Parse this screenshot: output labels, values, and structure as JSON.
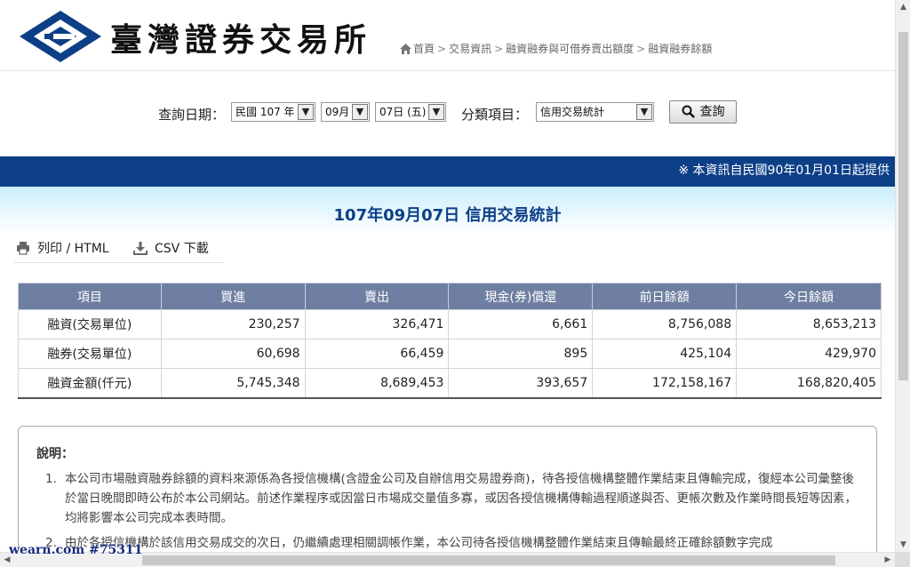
{
  "header": {
    "logo_text": "臺灣證券交易所",
    "breadcrumb": [
      "首頁",
      "交易資訊",
      "融資融券與可借券賣出額度",
      "融資融券餘額"
    ]
  },
  "query": {
    "date_label": "查詢日期：",
    "year": "民國 107 年",
    "month": "09月",
    "day": "07日 (五)",
    "category_label": "分類項目：",
    "category": "信用交易統計",
    "button_label": "查詢"
  },
  "notice": "※ 本資訊自民國90年01月01日起提供",
  "title": "107年09月07日 信用交易統計",
  "tools": {
    "print": "列印 / HTML",
    "csv": "CSV 下載"
  },
  "table": {
    "headers": [
      "項目",
      "買進",
      "賣出",
      "現金(券)償還",
      "前日餘額",
      "今日餘額"
    ],
    "rows": [
      [
        "融資(交易單位)",
        "230,257",
        "326,471",
        "6,661",
        "8,756,088",
        "8,653,213"
      ],
      [
        "融券(交易單位)",
        "60,698",
        "66,459",
        "895",
        "425,104",
        "429,970"
      ],
      [
        "融資金額(仟元)",
        "5,745,348",
        "8,689,453",
        "393,657",
        "172,158,167",
        "168,820,405"
      ]
    ]
  },
  "notes": {
    "heading": "說明：",
    "items": [
      "本公司市場融資融券餘額的資料來源係為各授信機構(含證金公司及自辦信用交易證券商)，待各授信機構整體作業結束且傳輸完成，復經本公司彙整後於當日晚間即時公布於本公司網站。前述作業程序或因當日市場成交量值多寡，或因各授信機構傳輸過程順遂與否、更帳次數及作業時間長短等因素，均將影響本公司完成本表時間。",
      "由於各授信機構於該信用交易成交的次日，仍繼續處理相關調帳作業，本公司待各授信機構整體作業結束且傳輸最終正確餘額數字完成"
    ]
  },
  "watermark": "wearn.com #75311",
  "colors": {
    "brand_blue": "#0d3f87",
    "table_header": "#6e7fa1"
  }
}
